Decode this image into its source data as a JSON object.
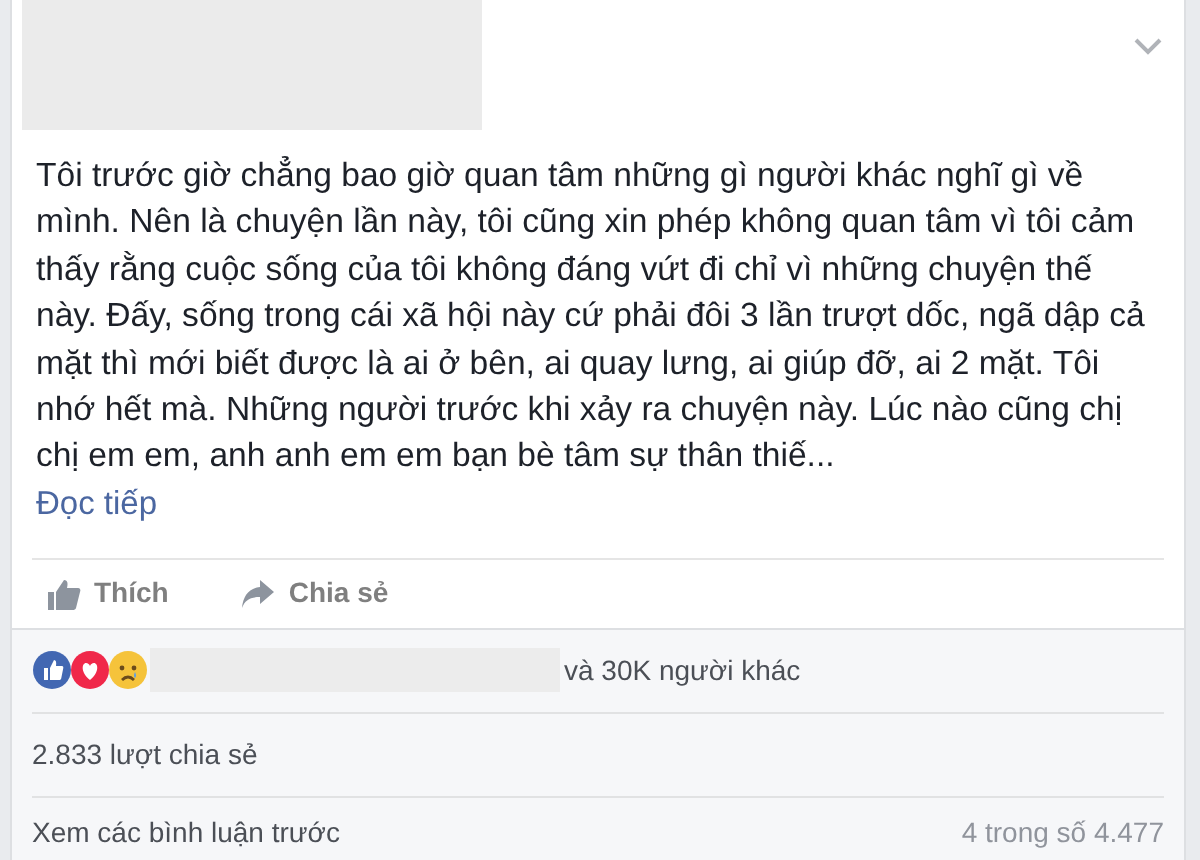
{
  "post": {
    "text": "Tôi trước giờ chẳng bao giờ quan tâm những gì người khác nghĩ gì về mình. Nên là chuyện lần này, tôi cũng xin phép không quan tâm vì tôi cảm thấy rằng cuộc sống của tôi không đáng vứt đi chỉ vì những chuyện thế này. Đấy, sống trong cái xã hội này cứ phải đôi 3 lần trượt dốc, ngã dập cả mặt thì mới biết được là ai ở bên, ai quay lưng, ai giúp đỡ, ai 2 mặt. Tôi nhớ hết mà. Những người trước khi xảy ra chuyện này. Lúc nào cũng chị chị em em, anh anh em em bạn bè tâm sự thân thiế...",
    "read_more": "Đọc tiếp"
  },
  "actions": [
    {
      "kind": "like",
      "label": "Thích"
    },
    {
      "kind": "share",
      "label": "Chia sẻ"
    }
  ],
  "reactions": {
    "icons": [
      {
        "kind": "like",
        "color": "#4267b2"
      },
      {
        "kind": "love",
        "color": "#f0284a"
      },
      {
        "kind": "sad",
        "color": "#f5c33b"
      }
    ],
    "others": "và 30K người khác"
  },
  "shares": "2.833 lượt chia sẻ",
  "comments": {
    "link": "Xem các bình luận trước",
    "count": "4 trong số 4.477"
  }
}
